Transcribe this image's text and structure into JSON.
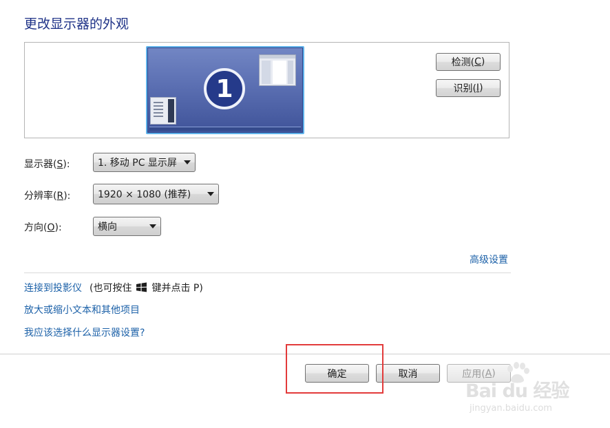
{
  "title": "更改显示器的外观",
  "preview": {
    "monitor_number": "1",
    "detect_button": {
      "text": "检测(",
      "mnemonic": "C",
      "suffix": ")"
    },
    "identify_button": {
      "text": "识别(",
      "mnemonic": "I",
      "suffix": ")"
    }
  },
  "fields": {
    "display": {
      "label": "显示器(",
      "mnemonic": "S",
      "suffix": "):",
      "value": "1. 移动 PC 显示屏"
    },
    "resolution": {
      "label": "分辨率(",
      "mnemonic": "R",
      "suffix": "):",
      "value": "1920 × 1080 (推荐)"
    },
    "orientation": {
      "label": "方向(",
      "mnemonic": "O",
      "suffix": "):",
      "value": "横向"
    }
  },
  "links": {
    "advanced": "高级设置",
    "projector": "连接到投影仪",
    "projector_hint_before": "(也可按住",
    "projector_hint_after": "键并点击 P)",
    "zoom_text": "放大或缩小文本和其他项目",
    "help": "我应该选择什么显示器设置?"
  },
  "footer": {
    "ok": "确定",
    "cancel": "取消",
    "apply": {
      "text": "应用(",
      "mnemonic": "A",
      "suffix": ")"
    }
  },
  "watermark": {
    "logo": "Bai du 经验",
    "url": "jingyan.baidu.com"
  },
  "colors": {
    "title": "#1e3287",
    "link": "#1c61a8",
    "highlight": "#e23a3a",
    "monitor": "#5b6fb2"
  },
  "icons": [
    "windows-logo-icon",
    "dropdown-arrow-icon",
    "baidu-paw-icon"
  ]
}
